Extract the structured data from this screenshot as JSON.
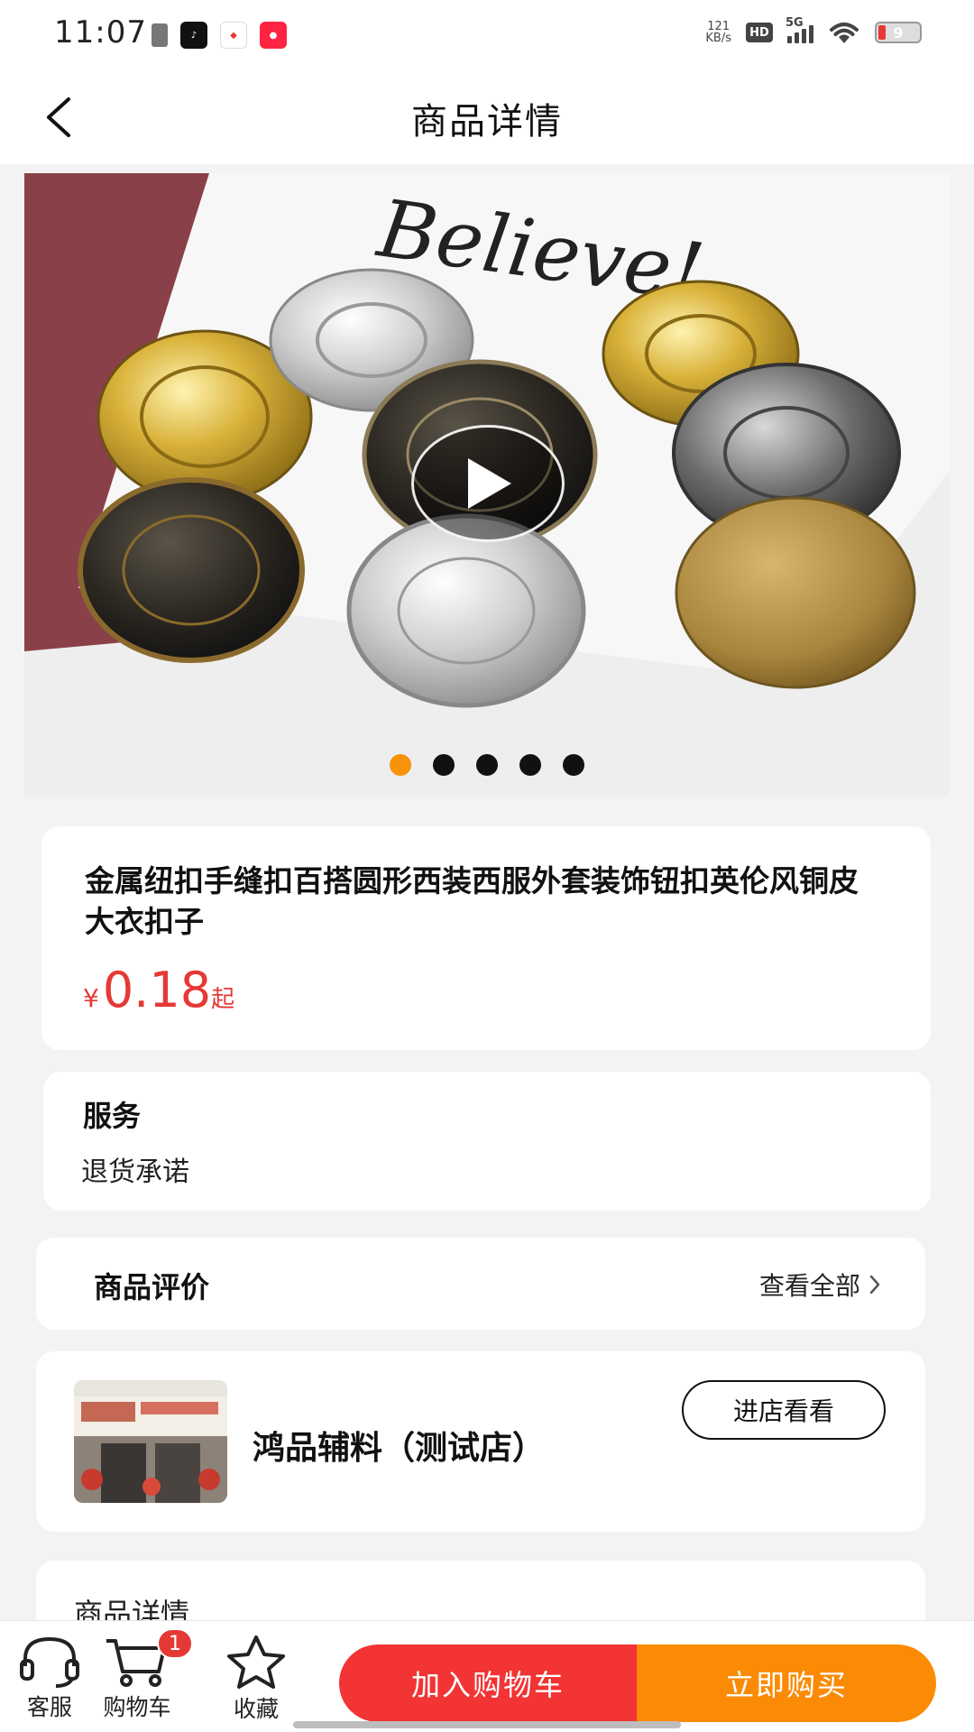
{
  "status_bar": {
    "time": "11:07",
    "net_speed_value": "121",
    "net_speed_unit": "KB/s",
    "hd_label": "HD",
    "network_label": "5G",
    "battery_level": "9",
    "battery_color": "#e53935"
  },
  "header": {
    "title": "商品详情"
  },
  "product": {
    "image_text": "Believe!",
    "carousel": {
      "count": 5,
      "active_index": 0,
      "active_color": "#f7930a"
    },
    "title": "金属纽扣手缝扣百搭圆形西装西服外套装饰钮扣英伦风铜皮大衣扣子",
    "price_symbol": "¥",
    "price_value": "0.18",
    "price_suffix": "起",
    "price_color": "#e53935"
  },
  "service": {
    "heading": "服务",
    "item": "退货承诺"
  },
  "reviews": {
    "heading": "商品评价",
    "view_all": "查看全部"
  },
  "shop": {
    "name": "鸿品辅料（测试店）",
    "visit_label": "进店看看"
  },
  "details": {
    "heading": "商品详情"
  },
  "bottom_bar": {
    "service_label": "客服",
    "cart_label": "购物车",
    "cart_badge": "1",
    "favorite_label": "收藏",
    "add_to_cart": "加入购物车",
    "buy_now": "立即购买",
    "add_color": "#f23434",
    "buy_color": "#fb8a05"
  }
}
